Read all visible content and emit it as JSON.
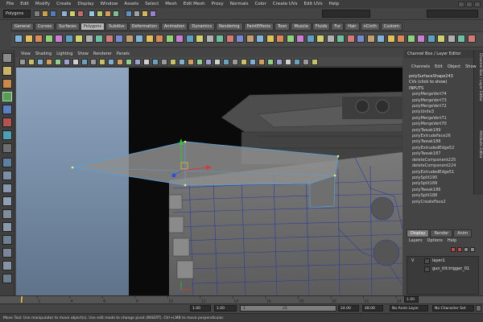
{
  "menubar": {
    "items": [
      "File",
      "Edit",
      "Modify",
      "Create",
      "Display",
      "Window",
      "Assets",
      "Select",
      "Mesh",
      "Edit Mesh",
      "Proxy",
      "Normals",
      "Color",
      "Create UVs",
      "Edit UVs",
      "Help"
    ]
  },
  "statusline": {
    "mode": "Polygons"
  },
  "shelf": {
    "tabs": [
      "General",
      "Curves",
      "Surfaces",
      "Polygons",
      "Subdivs",
      "Deformation",
      "Animation",
      "Dynamics",
      "Rendering",
      "PaintEffects",
      "Toon",
      "Muscle",
      "Fluids",
      "Fur",
      "Hair",
      "nCloth",
      "Custom"
    ],
    "active_tab": "Polygons"
  },
  "viewport": {
    "menu": [
      "View",
      "Shading",
      "Lighting",
      "Show",
      "Renderer",
      "Panels"
    ]
  },
  "channel_box": {
    "title": "Channel Box / Layer Editor",
    "side_tabs": [
      "Channel Box / Layer Editor",
      "Attribute Editor"
    ],
    "menu": [
      "Channels",
      "Edit",
      "Object",
      "Show"
    ],
    "shape": "polySurfaceShape243",
    "cvs": "CVs (click to show)",
    "inputs_label": "INPUTS",
    "inputs": [
      "polyMergeVert74",
      "polyMergeVert73",
      "polyMergeVert72",
      "polyUnite3",
      "polyMergeVert71",
      "polyMergeVert70",
      "polyTweak189",
      "polyExtrudeFace26",
      "polyTweak188",
      "polyExtrudedEdge52",
      "polyTweak187",
      "deleteComponent225",
      "deleteComponent224",
      "polyExtrudedEdge51",
      "polySplit190",
      "polySplit189",
      "polyTweak186",
      "polySplit188",
      "polyCreateFace2"
    ]
  },
  "layer_editor": {
    "tabs": [
      "Display",
      "Render",
      "Anim"
    ],
    "active_tab": "Display",
    "menu": [
      "Layers",
      "Options",
      "Help"
    ],
    "layers": [
      {
        "visible": "V",
        "name": "layer1"
      },
      {
        "visible": "",
        "name": "gun_tilt:trigger_01"
      }
    ]
  },
  "timeline": {
    "ticks": [
      "1",
      "2",
      "4",
      "6",
      "8",
      "10",
      "12",
      "14",
      "16",
      "18",
      "20",
      "22",
      "24"
    ],
    "current": "1.00"
  },
  "rangebar": {
    "start": "1.00",
    "inner_start": "1.00",
    "slider_start": "1",
    "slider_end": "24",
    "end": "24.00",
    "anim_end": "48.00",
    "anim_layer": "No Anim Layer",
    "char_set": "No Character Set"
  },
  "helpline": "Move Tool: Use manipulator to move object(s). Use edit mode to change pivot (INSERT). Ctrl+LMB to move perpendicular.",
  "colors": {
    "accent": "#5aa0d8",
    "active_tab": "#b8b8b8",
    "viewport_bg": "#000000",
    "gradient_bg": "#7c94b0"
  }
}
